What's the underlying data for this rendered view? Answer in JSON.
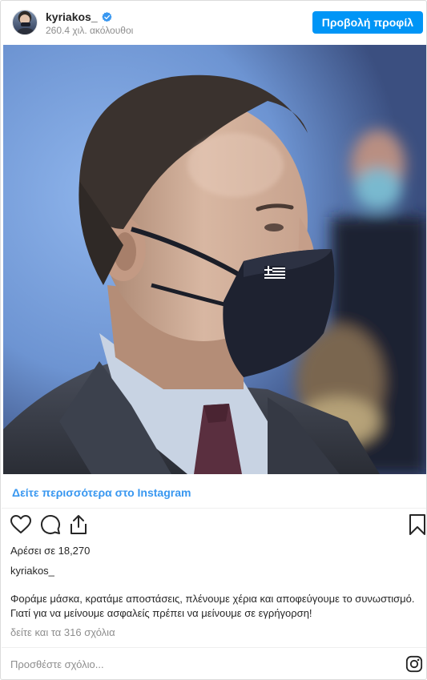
{
  "header": {
    "username": "kyriakos_",
    "followers": "260.4 χιλ. ακόλουθοι",
    "profile_button": "Προβολή προφίλ"
  },
  "post": {
    "see_more_link": "Δείτε περισσότερα στο Instagram",
    "likes": "Αρέσει σε 18,270",
    "author": "kyriakos_",
    "caption": "Φοράμε μάσκα, κρατάμε αποστάσεις, πλένουμε χέρια και αποφεύγουμε το συνωστισμό. Γιατί για να μείνουμε ασφαλείς πρέπει να μείνουμε σε εγρήγορση!",
    "comments_link": "δείτε και τα 316 σχόλια",
    "comment_placeholder": "Προσθέστε σχόλιο..."
  },
  "icons": {
    "heart": "heart-icon",
    "comment": "comment-icon",
    "share": "share-icon",
    "save": "bookmark-icon",
    "verified": "verified-badge-icon",
    "instagram": "instagram-logo-icon"
  },
  "colors": {
    "accent": "#0095f6",
    "link": "#3897f0",
    "muted": "#8e8e8e",
    "text": "#262626"
  }
}
